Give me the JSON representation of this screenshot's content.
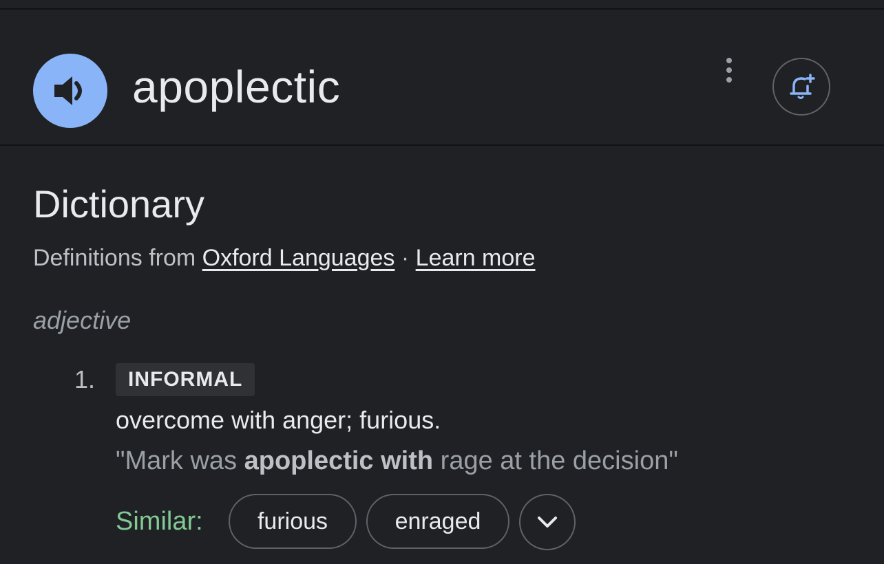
{
  "header": {
    "word": "apoplectic",
    "audio_icon": "speaker-icon",
    "more_icon": "more-vert-icon",
    "alert_icon": "bell-plus-icon"
  },
  "dictionary": {
    "title": "Dictionary",
    "source_prefix": "Definitions from",
    "source_link": "Oxford Languages",
    "separator": "·",
    "learn_more": "Learn more",
    "part_of_speech": "adjective",
    "senses": [
      {
        "number": "1.",
        "label": "INFORMAL",
        "definition": "overcome with anger; furious.",
        "example": {
          "open_quote": "\"Mark was ",
          "emphasis": "apoplectic with",
          "rest": " rage at the decision\""
        },
        "similar_label": "Similar:",
        "similar": [
          "furious",
          "enraged"
        ],
        "expand_icon": "chevron-down-icon"
      }
    ]
  },
  "colors": {
    "background": "#202124",
    "accent": "#8ab4f8",
    "similar": "#81c995",
    "chip_border": "#5f6368"
  }
}
